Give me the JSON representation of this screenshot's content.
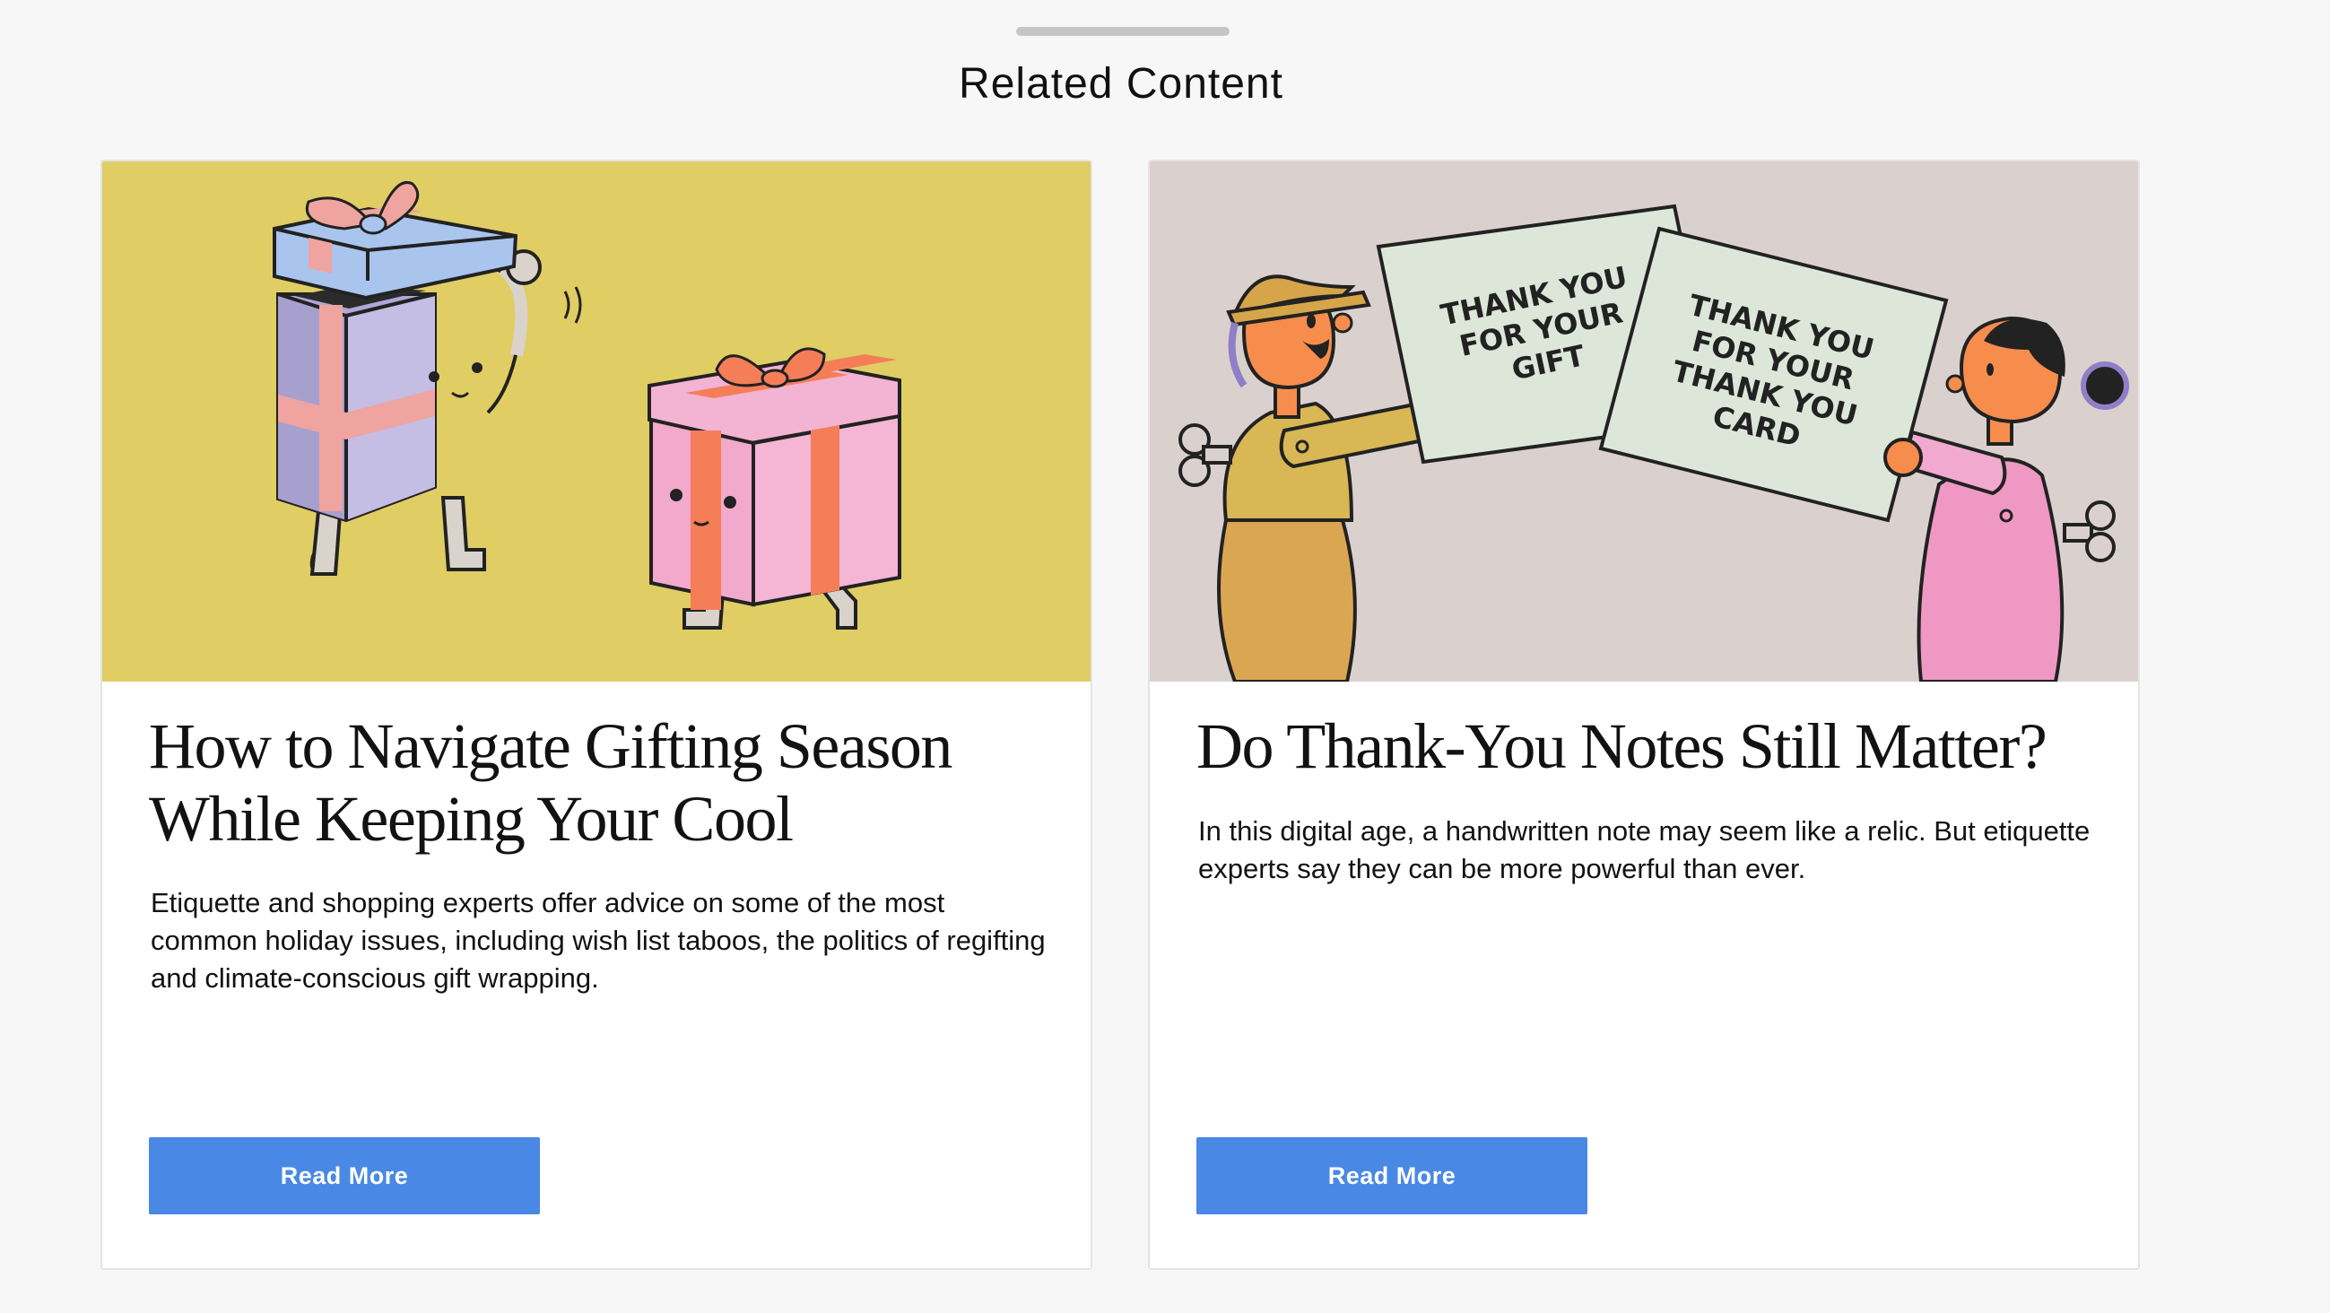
{
  "section": {
    "title": "Related Content"
  },
  "cards": [
    {
      "title": "How to Navigate Gifting Season While Keeping Your Cool",
      "description": "Etiquette and shopping experts offer advice on some of the most common holiday issues, including wish list taboos, the politics of regifting and climate-conscious gift wrapping.",
      "button_label": "Read More",
      "image_bg": "#e0cd64"
    },
    {
      "title": "Do Thank-You Notes Still Matter?",
      "description": "In this digital age, a handwritten note may seem like a relic. But etiquette experts say they can be more powerful than ever.",
      "button_label": "Read More",
      "image_bg": "#dad1cf",
      "image_text": {
        "card_left": [
          "THANK YOU",
          "FOR YOUR",
          "GIFT"
        ],
        "card_right": [
          "THANK YOU",
          "FOR YOUR",
          "THANK YOU",
          "CARD"
        ]
      }
    }
  ],
  "colors": {
    "button": "#4a88e5",
    "page_bg": "#f7f7f7"
  }
}
